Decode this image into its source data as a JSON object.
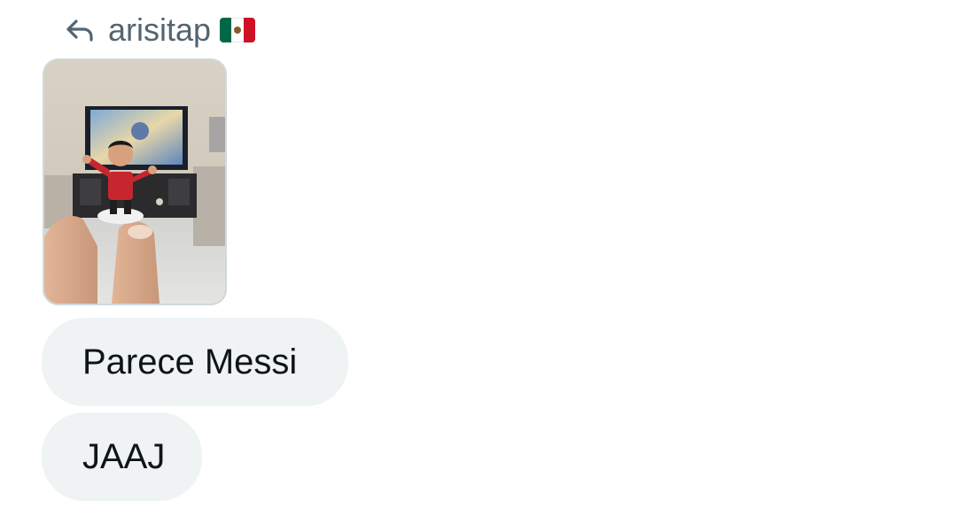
{
  "reply": {
    "icon": "reply-arrow-icon",
    "username": "arisitap",
    "flag": "mexico-flag-icon"
  },
  "attachment": {
    "type": "photo",
    "description_icon": "photo-attachment"
  },
  "messages": [
    {
      "text": "Parece Messi"
    },
    {
      "text": "JAAJ"
    }
  ],
  "colors": {
    "bubble_bg": "#eff3f4",
    "secondary_text": "#536471",
    "primary_text": "#0f1419"
  }
}
